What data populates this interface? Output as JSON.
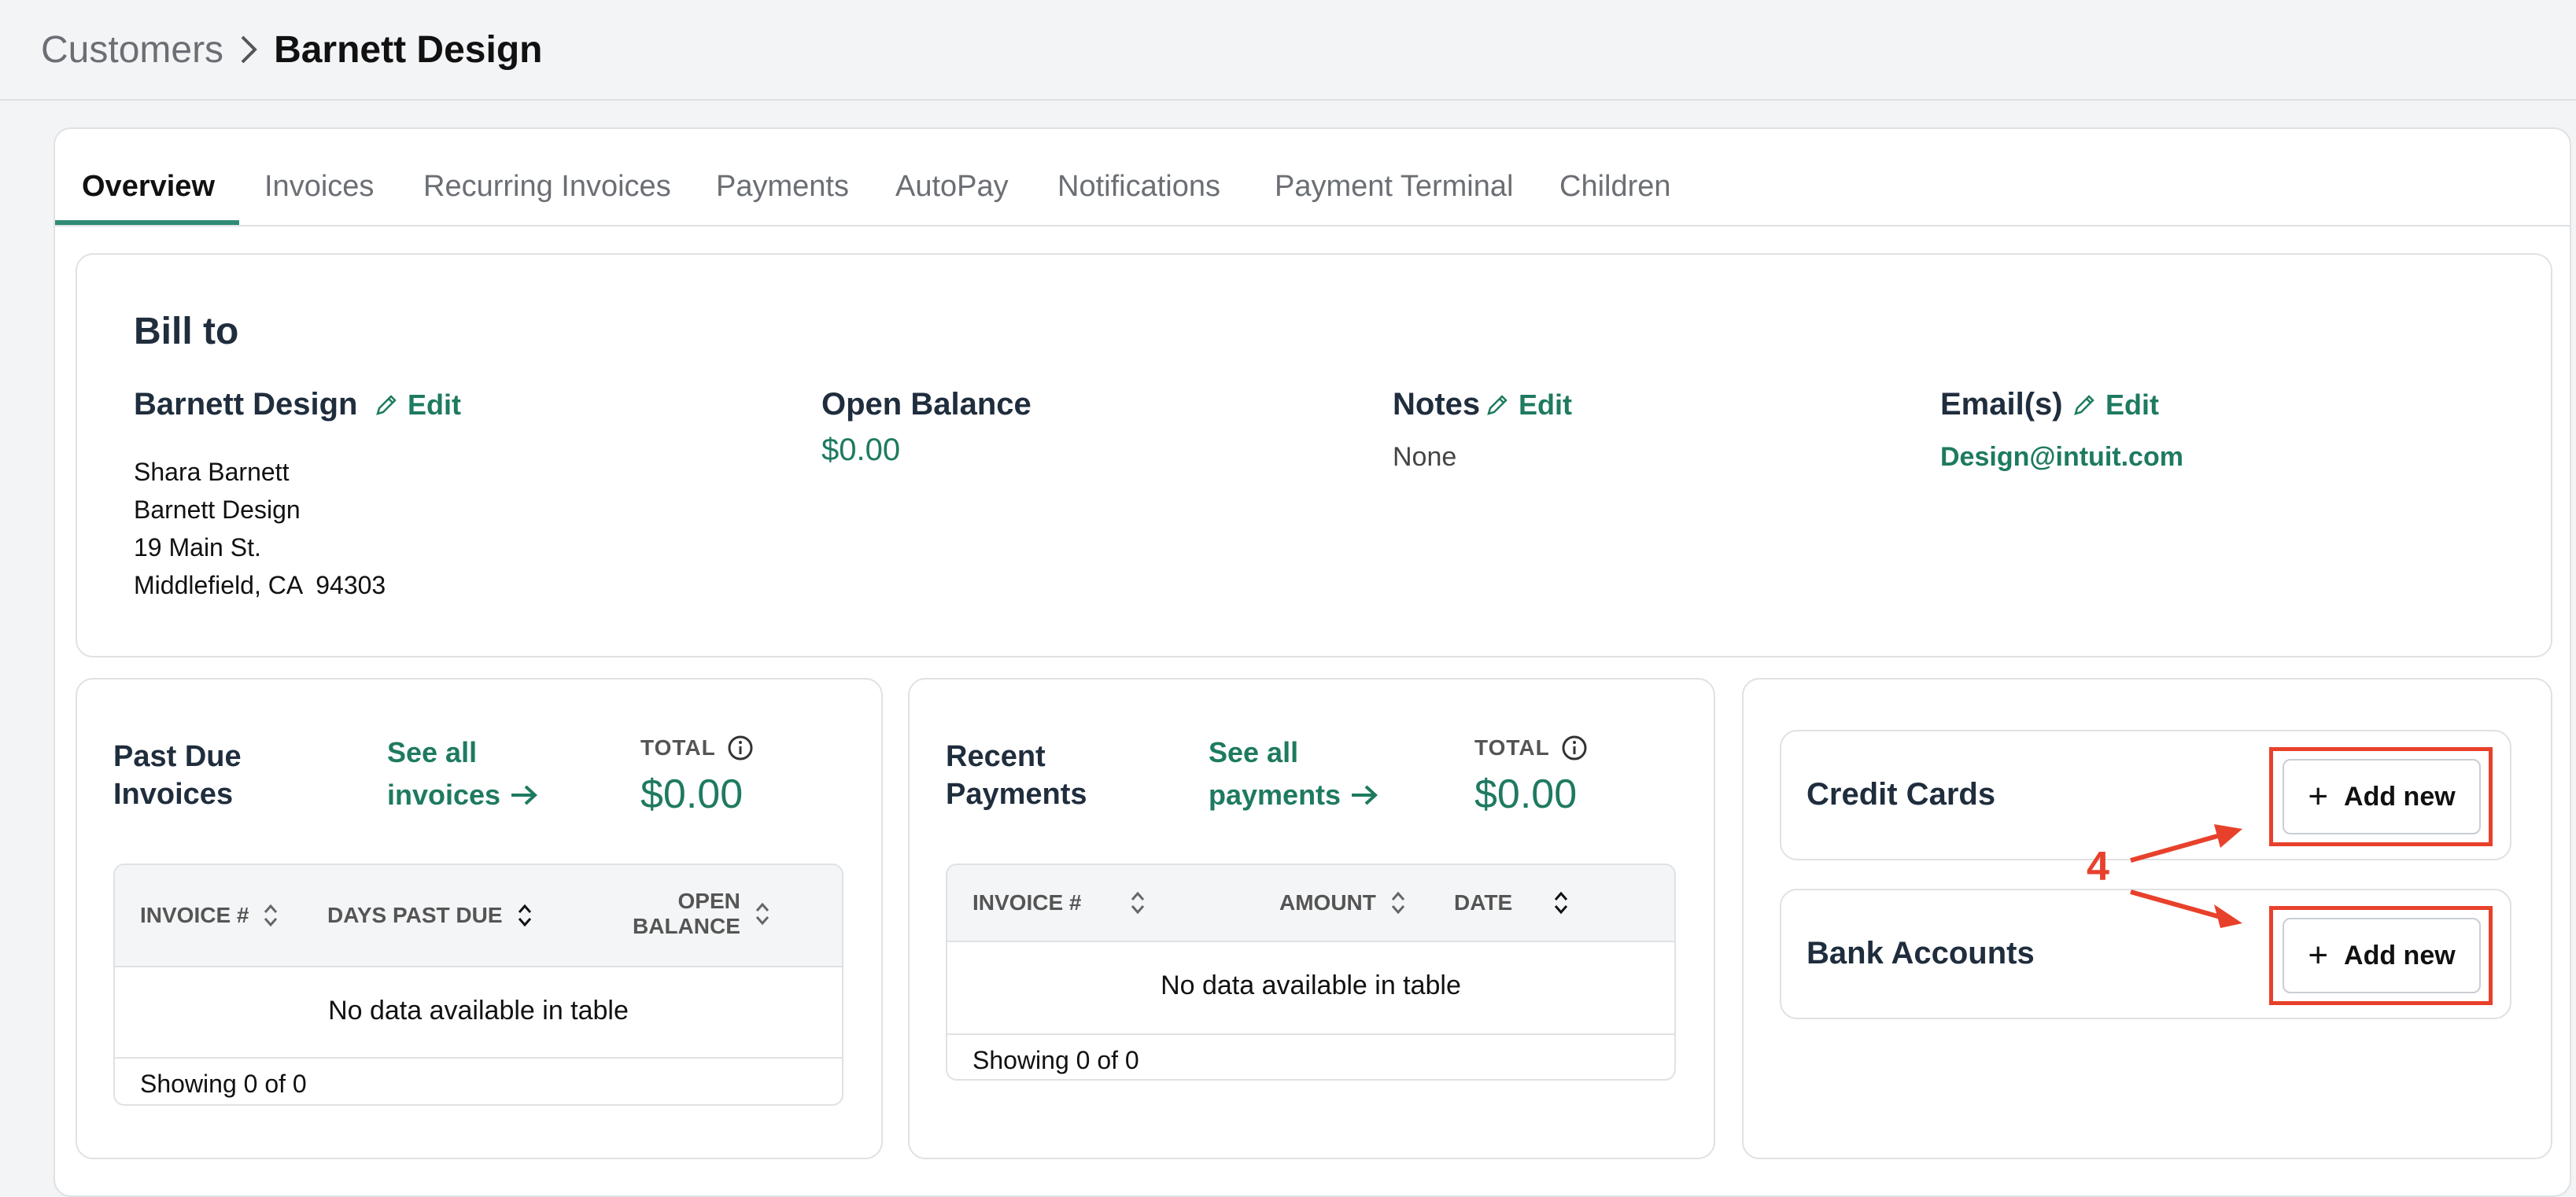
{
  "breadcrumb": {
    "parent": "Customers",
    "current": "Barnett Design"
  },
  "tabs": [
    "Overview",
    "Invoices",
    "Recurring Invoices",
    "Payments",
    "AutoPay",
    "Notifications",
    "Payment Terminal",
    "Children"
  ],
  "active_tab": "Overview",
  "bill_to": {
    "heading": "Bill to",
    "name": "Barnett Design",
    "edit_label": "Edit",
    "address_lines": [
      "Shara Barnett",
      "Barnett Design",
      "19 Main St.",
      "Middlefield, CA  94303"
    ],
    "open_balance_label": "Open Balance",
    "open_balance_value": "$0.00",
    "notes_label": "Notes",
    "notes_value": "None",
    "emails_label": "Email(s)",
    "email_value": "Design@intuit.com"
  },
  "past_due": {
    "title_line1": "Past Due",
    "title_line2": "Invoices",
    "see_all_line1": "See all",
    "see_all_line2": "invoices",
    "total_label": "TOTAL",
    "total_value": "$0.00",
    "columns": [
      "INVOICE #",
      "DAYS PAST DUE",
      "OPEN",
      "BALANCE"
    ],
    "empty_message": "No data available in table",
    "showing": "Showing 0 of 0"
  },
  "recent_payments": {
    "title_line1": "Recent",
    "title_line2": "Payments",
    "see_all_line1": "See all",
    "see_all_line2": "payments",
    "total_label": "TOTAL",
    "total_value": "$0.00",
    "columns": [
      "INVOICE #",
      "AMOUNT",
      "DATE"
    ],
    "empty_message": "No data available in table",
    "showing": "Showing 0 of 0"
  },
  "payment_methods": {
    "credit_cards_label": "Credit Cards",
    "bank_accounts_label": "Bank Accounts",
    "add_new_label": "Add new"
  },
  "annotation": {
    "step_number": "4",
    "color": "#e8412b"
  },
  "colors": {
    "accent": "#1e7a60",
    "tab_underline": "#2e8b74",
    "highlight": "#e8412b"
  }
}
